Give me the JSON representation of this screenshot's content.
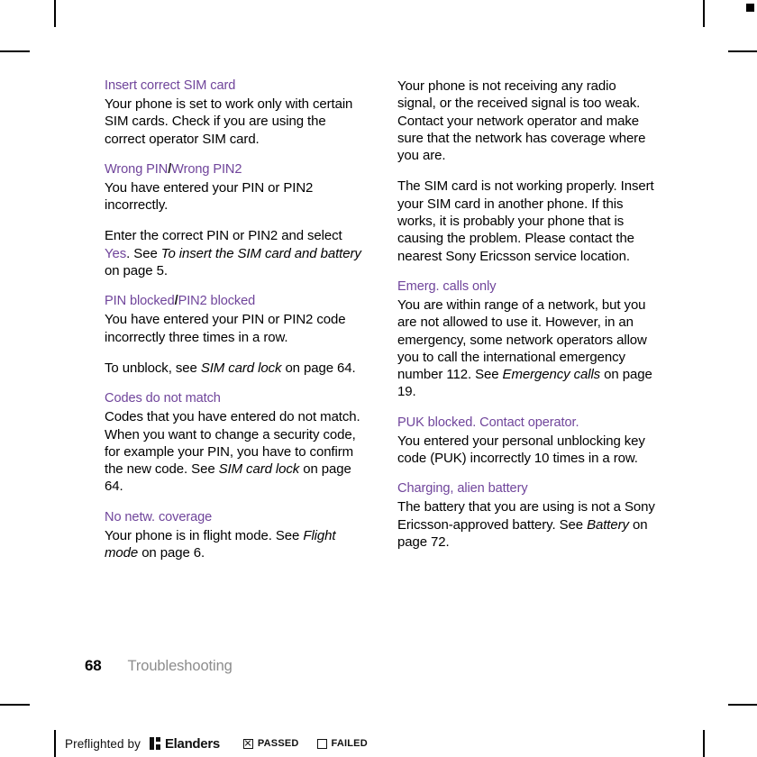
{
  "document": {
    "footer": {
      "page_number": "68",
      "section_title": "Troubleshooting"
    }
  },
  "left_column": {
    "blocks": [
      {
        "heading": "Insert correct SIM card",
        "paragraphs": [
          "Your phone is set to work only with certain SIM cards. Check if you are using the correct operator SIM card."
        ]
      },
      {
        "heading_part1": "Wrong PIN",
        "heading_sep": "/",
        "heading_part2": "Wrong PIN2",
        "paragraphs": [
          "You have entered your PIN or PIN2 incorrectly.",
          "Enter the correct PIN or PIN2 and select Yes. See To insert the SIM card and battery on page 5."
        ],
        "p2_pre": "Enter the correct PIN or PIN2 and select ",
        "p2_accent": "Yes",
        "p2_mid": ". See ",
        "p2_italic": "To insert the SIM card and battery",
        "p2_post": " on page 5."
      },
      {
        "heading_part1": "PIN blocked",
        "heading_sep": "/",
        "heading_part2": "PIN2 blocked",
        "paragraphs": [
          "You have entered your PIN or PIN2 code incorrectly three times in a row."
        ],
        "p2_pre": "To unblock, see ",
        "p2_italic": "SIM card lock",
        "p2_post": " on page 64."
      },
      {
        "heading": "Codes do not match",
        "p1_text": "Codes that you have entered do not match. When you want to change a security code, for example your PIN, you have to confirm the new code. See ",
        "p1_italic": "SIM card lock",
        "p1_post": " on page 64."
      },
      {
        "heading": "No netw. coverage",
        "p1_pre": "Your phone is in flight mode. See ",
        "p1_italic": "Flight mode",
        "p1_post": " on page 6."
      }
    ]
  },
  "right_column": {
    "blocks": [
      {
        "paragraphs": [
          "Your phone is not receiving any radio signal, or the received signal is too weak. Contact your network operator and make sure that the network has coverage where you are.",
          "The SIM card is not working properly. Insert your SIM card in another phone. If this works, it is probably your phone that is causing the problem. Please contact the nearest Sony Ericsson service location."
        ]
      },
      {
        "heading": "Emerg. calls only",
        "p1_pre": "You are within range of a network, but you are not allowed to use it. However, in an emergency, some network operators allow you to call the international emergency number 112. See ",
        "p1_italic": "Emergency calls",
        "p1_post": " on page 19."
      },
      {
        "heading": "PUK blocked. Contact operator.",
        "paragraphs": [
          "You entered your personal unblocking key code (PUK) incorrectly 10 times in a row."
        ]
      },
      {
        "heading": "Charging, alien battery",
        "p1_pre": "The battery that you are using is not a Sony Ericsson-approved battery. See ",
        "p1_italic": "Battery",
        "p1_post": " on page 72."
      }
    ]
  },
  "preflight": {
    "label": "Preflighted by",
    "brand": "Elanders",
    "passed_label": "PASSED",
    "failed_label": "FAILED",
    "passed_checked": true,
    "failed_checked": false
  },
  "colors": {
    "heading_purple": "#70459b",
    "body_black": "#000000",
    "footer_gray": "#8c8c8c"
  }
}
